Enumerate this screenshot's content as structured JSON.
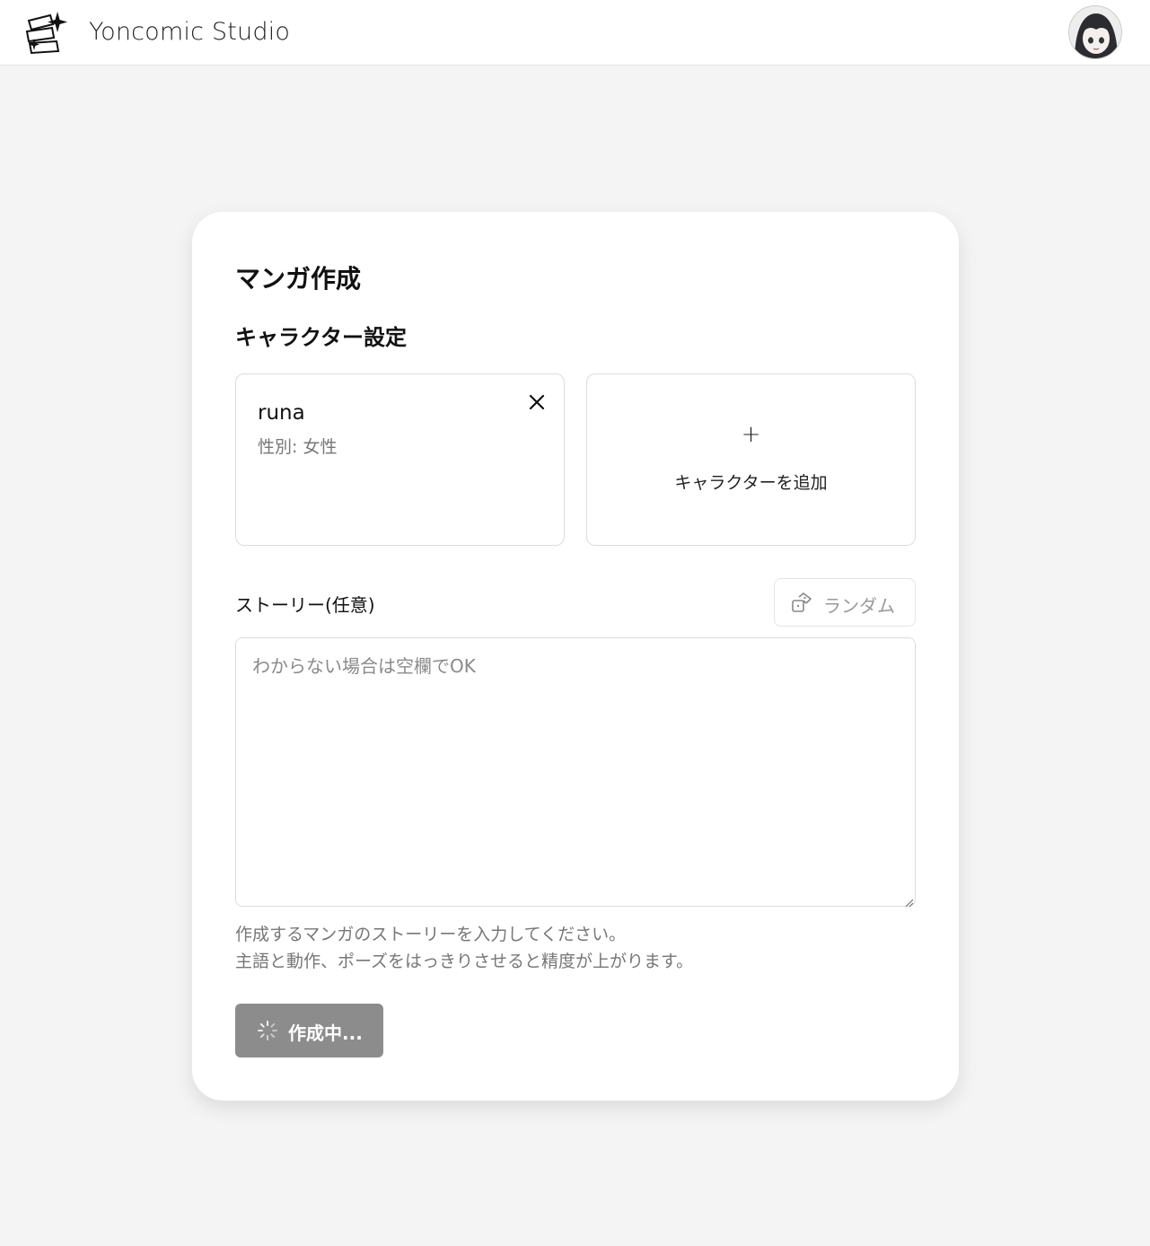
{
  "header": {
    "app_title": "Yoncomic Studio",
    "logo_icon": "sparkle-cards-logo",
    "avatar_icon": "user-avatar-anime-girl"
  },
  "main": {
    "page_title": "マンガ作成",
    "characters_section_title": "キャラクター設定",
    "characters": [
      {
        "name": "runa",
        "gender": "性別: 女性"
      }
    ],
    "remove_character_icon": "close-icon",
    "add_character": {
      "plus": "+",
      "label": "キャラクターを追加"
    },
    "story": {
      "label": "ストーリー(任意)",
      "random_button_label": "ランダム",
      "random_icon": "dice-icon",
      "value": "",
      "placeholder": "わからない場合は空欄でOK",
      "help_line1": "作成するマンガのストーリーを入力してください。",
      "help_line2": "主語と動作、ポーズをはっきりさせると精度が上がります。"
    },
    "submit": {
      "label": "作成中...",
      "icon": "spinner-icon",
      "state": "loading"
    }
  },
  "colors": {
    "page_background": "#f4f4f4",
    "card_background": "#ffffff",
    "submit_button_loading": "#8c8c8c",
    "muted_text": "#777777"
  }
}
